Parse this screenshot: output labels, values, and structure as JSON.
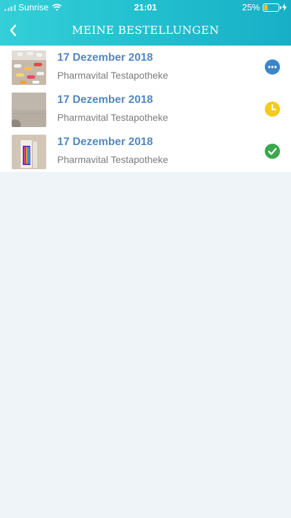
{
  "status_bar": {
    "carrier": "Sunrise",
    "time": "21:01",
    "battery_percent": "25%",
    "battery_level": 0.25
  },
  "header": {
    "title": "MEINE BESTELLUNGEN"
  },
  "orders": [
    {
      "date": "17 Dezember 2018",
      "pharmacy": "Pharmavital Testapotheke",
      "status_icon": "more-dots-icon",
      "status_color": "#3a87c8"
    },
    {
      "date": "17 Dezember 2018",
      "pharmacy": "Pharmavital Testapotheke",
      "status_icon": "clock-icon",
      "status_color": "#f4cb1a"
    },
    {
      "date": "17 Dezember 2018",
      "pharmacy": "Pharmavital Testapotheke",
      "status_icon": "check-icon",
      "status_color": "#3aa84c"
    }
  ],
  "colors": {
    "header_start": "#34cfd8",
    "header_end": "#18afc6",
    "date_text": "#5188c0",
    "background": "#eff4f8"
  }
}
